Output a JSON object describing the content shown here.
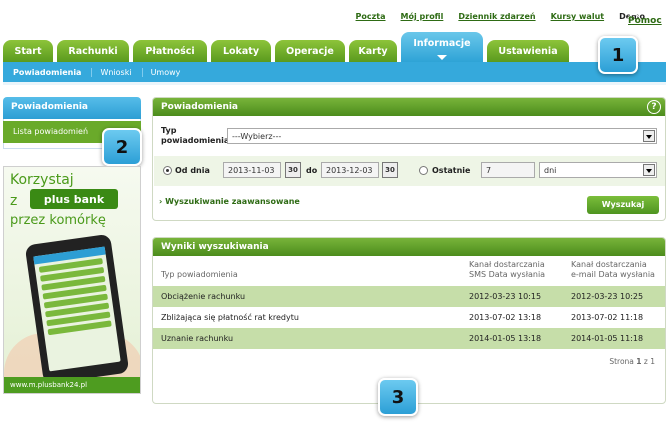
{
  "top_links": [
    "Poczta",
    "Mój profil",
    "Dziennik zdarzeń",
    "Kursy walut",
    "Demo",
    "Pomoc"
  ],
  "nav": {
    "tabs": [
      "Start",
      "Rachunki",
      "Płatności",
      "Lokaty",
      "Operacje",
      "Karty",
      "Informacje",
      "Ustawienia"
    ],
    "active": "Informacje",
    "sub": [
      "Powiadomienia",
      "Wnioski",
      "Umowy"
    ]
  },
  "badges": [
    "1",
    "2",
    "3"
  ],
  "sidebar": {
    "title": "Powiadomienia",
    "item": "Lista powiadomień"
  },
  "ad": {
    "line1": "Korzystaj",
    "line2_prefix": "z",
    "brand": "plus bank",
    "line3": "przez komórkę",
    "url": "www.m.plusbank24.pl"
  },
  "search": {
    "title": "Powiadomienia",
    "help": "?",
    "type_label": "Typ powiadomienia",
    "type_value": "---Wybierz---",
    "from_label": "Od dnia",
    "from_date": "2013-11-03",
    "to_label": "do",
    "to_date": "2013-12-03",
    "cal": "30",
    "last_label": "Ostatnie",
    "last_value": "7",
    "unit": "dni",
    "advanced": "Wyszukiwanie zaawansowane",
    "button": "Wyszukaj"
  },
  "results": {
    "title": "Wyniki wyszukiwania",
    "headers": [
      "Typ powiadomienia",
      "Kanał dostarczania SMS Data wysłania",
      "Kanał dostarczania e-mail Data wysłania"
    ],
    "rows": [
      [
        "Obciążenie rachunku",
        "2012-03-23 10:15",
        "2012-03-23 10:25"
      ],
      [
        "Zbliżająca się płatność rat kredytu",
        "2013-07-02 13:18",
        "2013-07-02 11:18"
      ],
      [
        "Uznanie rachunku",
        "2014-01-05 13:18",
        "2014-01-05 11:18"
      ]
    ],
    "pager_prefix": "Strona",
    "pager_page": "1",
    "pager_suffix": "z 1"
  }
}
